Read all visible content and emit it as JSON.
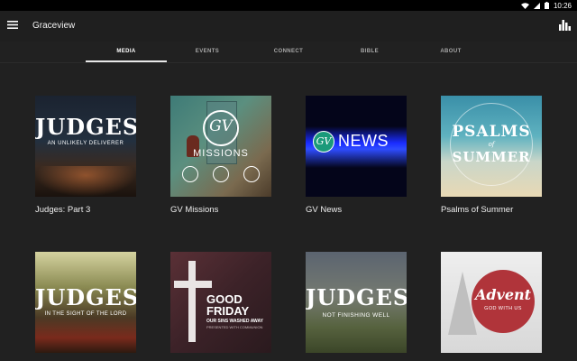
{
  "status": {
    "time": "10:26"
  },
  "app": {
    "title": "Graceview"
  },
  "tabs": [
    {
      "label": "MEDIA",
      "active": true
    },
    {
      "label": "EVENTS",
      "active": false
    },
    {
      "label": "CONNECT",
      "active": false
    },
    {
      "label": "BIBLE",
      "active": false
    },
    {
      "label": "ABOUT",
      "active": false
    }
  ],
  "cards": [
    {
      "title": "Judges: Part 3",
      "art": {
        "line1": "JUDGES",
        "line2": "AN UNLIKELY DELIVERER"
      }
    },
    {
      "title": "GV Missions",
      "art": {
        "line1": "GV",
        "line2": "MISSIONS"
      }
    },
    {
      "title": "GV News",
      "art": {
        "line1": "GV",
        "line2": "NEWS"
      }
    },
    {
      "title": "Psalms of Summer",
      "art": {
        "line1": "PSALMS",
        "line2": "of",
        "line3": "SUMMER"
      }
    },
    {
      "title": "",
      "art": {
        "line1": "JUDGES",
        "line2": "IN THE SIGHT OF THE LORD"
      }
    },
    {
      "title": "",
      "art": {
        "line1": "GOOD",
        "line2": "FRIDAY",
        "line3": "OUR SINS WASHED AWAY",
        "line4": "PRESENTED WITH COMMUNION"
      }
    },
    {
      "title": "",
      "art": {
        "line1": "JUDGES",
        "line2": "NOT FINISHING WELL"
      }
    },
    {
      "title": "",
      "art": {
        "line1": "Advent",
        "line2": "GOD WITH US"
      }
    }
  ],
  "colors": {
    "background": "#212121",
    "app_bar": "#1f1f1f",
    "status_bar": "#000000",
    "tab_indicator": "#e8e8e8"
  },
  "icons": {
    "menu": "hamburger-icon",
    "stats": "bar-chart-icon",
    "wifi": "wifi-icon",
    "signal": "signal-icon",
    "battery": "battery-icon"
  }
}
